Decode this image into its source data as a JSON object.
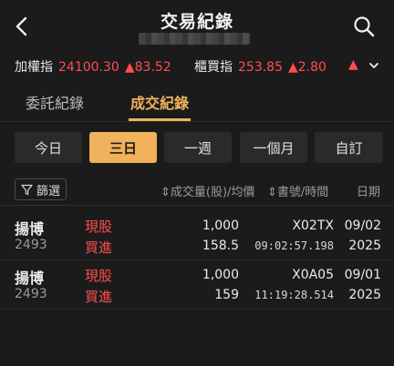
{
  "header": {
    "title": "交易紀錄"
  },
  "ticker": {
    "idx1": {
      "label": "加權指",
      "value": "24100.30",
      "change": "▲83.52"
    },
    "idx2": {
      "label": "櫃買指",
      "value": "253.85",
      "change": "▲2.80"
    },
    "more": "▲"
  },
  "tabs": [
    {
      "label": "委託紀錄"
    },
    {
      "label": "成交紀錄"
    }
  ],
  "periods": [
    {
      "label": "今日"
    },
    {
      "label": "三日"
    },
    {
      "label": "一週"
    },
    {
      "label": "一個月"
    },
    {
      "label": "自訂"
    }
  ],
  "filter": {
    "label": "篩選",
    "col_qty_price": "⇕成交量(股)/均價",
    "col_book_time": "⇕書號/時間",
    "col_date": "日期"
  },
  "rows": [
    {
      "name": "揚博",
      "code": "2493",
      "type": "現股",
      "side": "買進",
      "qty": "1,000",
      "price": "158.5",
      "book_no": "X02TX",
      "time": "09:02:57.198",
      "date_md": "09/02",
      "date_y": "2025"
    },
    {
      "name": "揚博",
      "code": "2493",
      "type": "現股",
      "side": "買進",
      "qty": "1,000",
      "price": "159",
      "book_no": "X0A05",
      "time": "11:19:28.514",
      "date_md": "09/01",
      "date_y": "2025"
    }
  ],
  "colors": {
    "accent": "#f0b25a",
    "up": "#ff4d4f",
    "bg": "#1b1b1b"
  },
  "icons": {
    "back": "chevron-left-icon",
    "search": "search-icon",
    "filter": "funnel-icon",
    "expand": "chevron-down-icon"
  }
}
